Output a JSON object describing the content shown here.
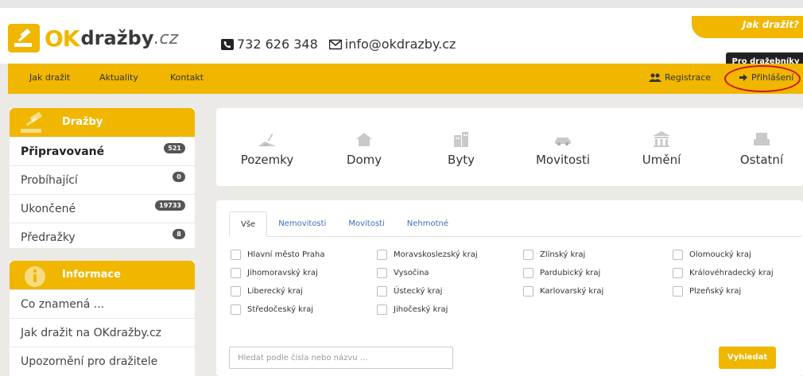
{
  "header": {
    "logo": {
      "ok": "OK",
      "brand": "dražby",
      "tld": ".cz"
    },
    "phone": "732 626 348",
    "email": "info@okdrazby.cz",
    "jak_drazit_tab": "Jak dražit?",
    "pro_drazebniky": "Pro dražebníky"
  },
  "nav": {
    "items": [
      "Jak dražit",
      "Aktuality",
      "Kontakt"
    ],
    "registrace": "Registrace",
    "prihlaseni": "Přihlášení"
  },
  "sidebar": {
    "drazby_title": "Dražby",
    "drazby_items": [
      {
        "label": "Připravované",
        "count": "521",
        "active": true
      },
      {
        "label": "Probíhající",
        "count": "0"
      },
      {
        "label": "Ukončené",
        "count": "19733"
      },
      {
        "label": "Předražky",
        "count": "8"
      }
    ],
    "info_title": "Informace",
    "info_items": [
      "Co znamená ...",
      "Jak dražit na OKdražby.cz",
      "Upozornění pro dražitele"
    ]
  },
  "categories": [
    "Pozemky",
    "Domy",
    "Byty",
    "Movitosti",
    "Umění",
    "Ostatní"
  ],
  "search": {
    "tabs": [
      "Vše",
      "Nemovitosti",
      "Movitosti",
      "Nehmotné"
    ],
    "regions": [
      "Hlavní město Praha",
      "Moravskoslezský kraj",
      "Zlínský kraj",
      "Olomoucký kraj",
      "Jihomoravský kraj",
      "Vysočina",
      "Pardubický kraj",
      "Královéhradecký kraj",
      "Liberecký kraj",
      "Ústecký kraj",
      "Karlovarský kraj",
      "Plzeňský kraj",
      "Středočeský kraj",
      "Jihočeský kraj"
    ],
    "placeholder": "Hledat podle čísla nebo názvu ...",
    "button": "Vyhledat"
  },
  "colors": {
    "accent": "#f0b600",
    "highlight_oval": "#d0121a"
  }
}
